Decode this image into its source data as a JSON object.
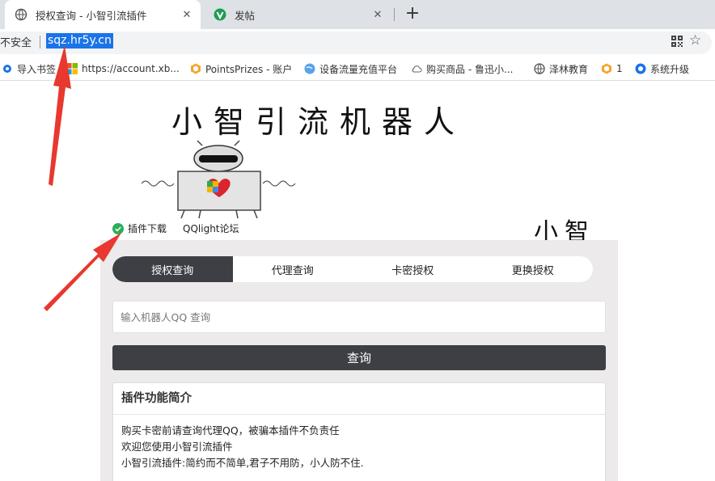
{
  "browser": {
    "tabs": [
      {
        "title": "授权查询 - 小智引流插件",
        "active": true
      },
      {
        "title": "发帖",
        "active": false
      }
    ],
    "new_tab": "+",
    "close": "✕",
    "security_label": "不安全",
    "url": "sqz.hr5y.cn",
    "bookmarks": [
      {
        "label": "导入书签",
        "icon": "gear-icon"
      },
      {
        "label": "https://account.xb...",
        "icon": "windows-icon"
      },
      {
        "label": "PointsPrizes - 账户",
        "icon": "hexagon-icon"
      },
      {
        "label": "设备流量充值平台",
        "icon": "globe-icon"
      },
      {
        "label": "购买商品 - 鲁迅小...",
        "icon": "cloud-icon"
      },
      {
        "label": "泽林教育",
        "icon": "globe-icon"
      },
      {
        "label": "1",
        "icon": "hexagon-icon"
      },
      {
        "label": "系统升级",
        "icon": "blue-circle-icon"
      }
    ]
  },
  "page": {
    "banner": "小智引流机器人",
    "banner_small": "小智",
    "links": {
      "download": "插件下载",
      "forum": "QQlight论坛"
    },
    "tabs": [
      "授权查询",
      "代理查询",
      "卡密授权",
      "更换授权"
    ],
    "search_placeholder": "输入机器人QQ 查询",
    "query_button": "查询",
    "card": {
      "title": "插件功能简介",
      "lines": [
        "购买卡密前请查询代理QQ，被骗本插件不负责任",
        "欢迎您使用小智引流插件",
        "小智引流插件:简约而不简单,君子不用防，小人防不住."
      ]
    }
  },
  "colors": {
    "dark": "#3d3f45",
    "accent_blue": "#1a73e8",
    "arrow_red": "#e8382f",
    "panel_bg": "#eceaea"
  }
}
